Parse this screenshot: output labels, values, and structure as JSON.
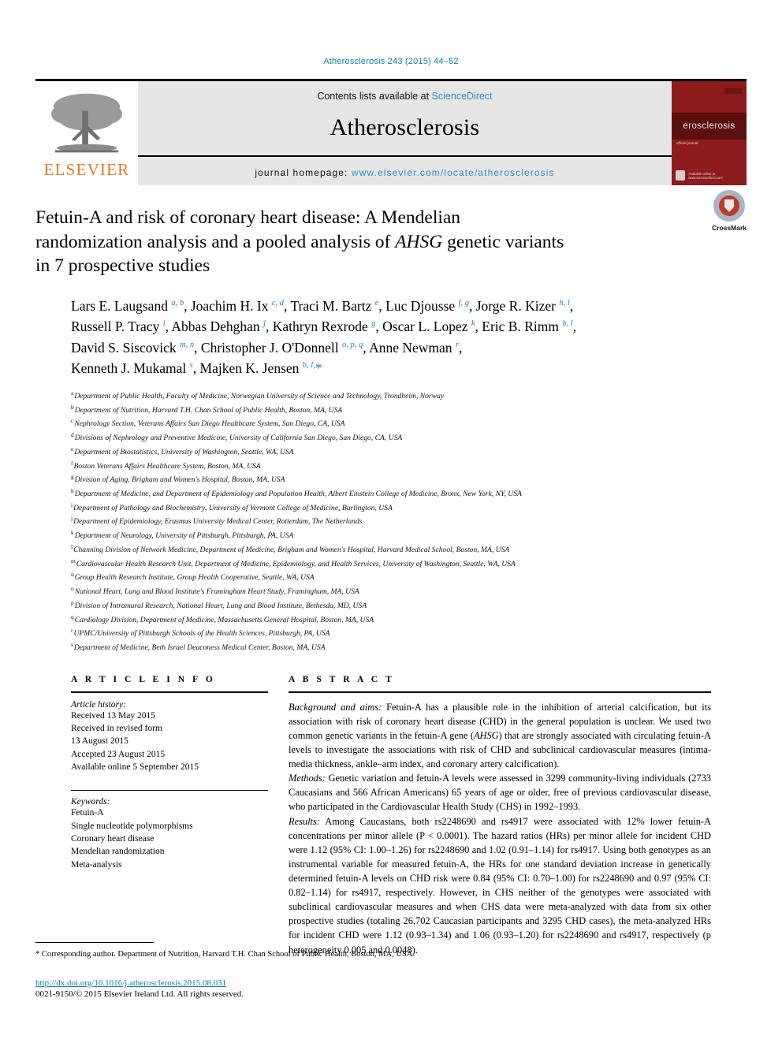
{
  "running_head": "Atherosclerosis 243 (2015) 44–52",
  "masthead": {
    "publisher_name": "ELSEVIER",
    "publisher_logo_icon": "elsevier-tree-icon",
    "contents_prefix": "Contents lists available at ",
    "contents_link": "ScienceDirect",
    "journal_name": "Atherosclerosis",
    "homepage_label": "journal homepage: ",
    "homepage_url": "www.elsevier.com/locate/atherosclerosis",
    "cover_title": "erosclerosis",
    "cover_subtitle": "official journal",
    "cover_footer": "Available online at www.sciencedirect.com"
  },
  "title": {
    "line1": "Fetuin-A and risk of coronary heart disease: A Mendelian",
    "line2_pre": "randomization analysis and a pooled analysis of ",
    "line2_italic": "AHSG",
    "line2_post": " genetic variants",
    "line3": "in 7 prospective studies"
  },
  "crossmark": {
    "label": "CrossMark",
    "icon": "crossmark-icon"
  },
  "authors_html": "Lars E. Laugsand <sup>a, b</sup>, Joachim H. Ix <sup>c, d</sup>, Traci M. Bartz <sup>e</sup>, Luc Djousse <sup>f, g</sup>, Jorge R. Kizer <sup>h, l</sup>,<br>Russell P. Tracy <sup>i</sup>, Abbas Dehghan <sup>j</sup>, Kathryn Rexrode <sup>g</sup>, Oscar L. Lopez <sup>k</sup>, Eric B. Rimm <sup>b, l</sup>,<br>David S. Siscovick <sup>m, n</sup>, Christopher J. O'Donnell <sup>o, p, q</sup>, Anne Newman <sup>r</sup>,<br>Kenneth J. Mukamal <sup>s</sup>, Majken K. Jensen <sup>b, l,</sup><span class=\"corr\">*</span>",
  "affiliations": [
    {
      "marker": "a",
      "text": "Department of Public Health, Faculty of Medicine, Norwegian University of Science and Technology, Trondheim, Norway"
    },
    {
      "marker": "b",
      "text": "Department of Nutrition, Harvard T.H. Chan School of Public Health, Boston, MA, USA"
    },
    {
      "marker": "c",
      "text": "Nephrology Section, Veterans Affairs San Diego Healthcare System, San Diego, CA, USA"
    },
    {
      "marker": "d",
      "text": "Divisions of Nephrology and Preventive Medicine, University of California San Diego, San Diego, CA, USA"
    },
    {
      "marker": "e",
      "text": "Department of Biostatistics, University of Washington, Seattle, WA, USA"
    },
    {
      "marker": "f",
      "text": "Boston Veterans Affairs Healthcare System, Boston, MA, USA"
    },
    {
      "marker": "g",
      "text": "Division of Aging, Brigham and Women's Hospital, Boston, MA, USA"
    },
    {
      "marker": "h",
      "text": "Department of Medicine, and Department of Epidemiology and Population Health, Albert Einstein College of Medicine, Bronx, New York, NY, USA"
    },
    {
      "marker": "i",
      "text": "Department of Pathology and Biochemistry, University of Vermont College of Medicine, Burlington, USA"
    },
    {
      "marker": "j",
      "text": "Department of Epidemiology, Erasmus University Medical Center, Rotterdam, The Netherlands"
    },
    {
      "marker": "k",
      "text": "Department of Neurology, University of Pittsburgh, Pittsburgh, PA, USA"
    },
    {
      "marker": "l",
      "text": "Channing Division of Network Medicine, Department of Medicine, Brigham and Women's Hospital, Harvard Medical School, Boston, MA, USA"
    },
    {
      "marker": "m",
      "text": "Cardiovascular Health Research Unit, Department of Medicine, Epidemiology, and Health Services, University of Washington, Seattle, WA, USA"
    },
    {
      "marker": "n",
      "text": "Group Health Research Institute, Group Health Cooperative, Seattle, WA, USA"
    },
    {
      "marker": "o",
      "text": "National Heart, Lung and Blood Institute's Framingham Heart Study, Framingham, MA, USA"
    },
    {
      "marker": "p",
      "text": "Division of Intramural Research, National Heart, Lung and Blood Institute, Bethesda, MD, USA"
    },
    {
      "marker": "q",
      "text": "Cardiology Division, Department of Medicine, Massachusetts General Hospital, Boston, MA, USA"
    },
    {
      "marker": "r",
      "text": "UPMC/University of Pittsburgh Schools of the Health Sciences, Pittsburgh, PA, USA"
    },
    {
      "marker": "s",
      "text": "Department of Medicine, Beth Israel Deaconess Medical Center, Boston, MA, USA"
    }
  ],
  "article_info": {
    "heading": "A R T I C L E   I N F O",
    "history_label": "Article history:",
    "history": [
      "Received 13 May 2015",
      "Received in revised form",
      "13 August 2015",
      "Accepted 23 August 2015",
      "Available online 5 September 2015"
    ],
    "keywords_label": "Keywords:",
    "keywords": [
      "Fetuin-A",
      "Single nucleotide polymorphisms",
      "Coronary heart disease",
      "Mendelian randomization",
      "Meta-analysis"
    ]
  },
  "abstract": {
    "heading": "A B S T R A C T",
    "background_label": "Background and aims:",
    "background_text": " Fetuin-A has a plausible role in the inhibition of arterial calcification, but its association with risk of coronary heart disease (CHD) in the general population is unclear. We used two common genetic variants in the fetuin-A gene (AHSG) that are strongly associated with circulating fetuin-A levels to investigate the associations with risk of CHD and subclinical cardiovascular measures (intima-media thickness, ankle–arm index, and coronary artery calcification).",
    "methods_label": "Methods:",
    "methods_text": " Genetic variation and fetuin-A levels were assessed in 3299 community-living individuals (2733 Caucasians and 566 African Americans) 65 years of age or older, free of previous cardiovascular disease, who participated in the Cardiovascular Health Study (CHS) in 1992–1993.",
    "results_label": "Results:",
    "results_text": " Among Caucasians, both rs2248690 and rs4917 were associated with 12% lower fetuin-A concentrations per minor allele (P < 0.0001). The hazard ratios (HRs) per minor allele for incident CHD were 1.12 (95% CI: 1.00–1.26) for rs2248690 and 1.02 (0.91–1.14) for rs4917. Using both genotypes as an instrumental variable for measured fetuin-A, the HRs for one standard deviation increase in genetically determined fetuin-A levels on CHD risk were 0.84 (95% CI: 0.70–1.00) for rs2248690 and 0.97 (95% CI: 0.82–1.14) for rs4917, respectively. However, in CHS neither of the genotypes were associated with subclinical cardiovascular measures and when CHS data were meta-analyzed with data from six other prospective studies (totaling 26,702 Caucasian participants and 3295 CHD cases), the meta-analyzed HRs for incident CHD were 1.12 (0.93–1.34) and 1.06 (0.93–1.20) for rs2248690 and rs4917, respectively (p heterogeneity 0.005 and 0.0048)."
  },
  "footer": {
    "corresponding_marker": "*",
    "corresponding_text": " Corresponding author. Department of Nutrition, Harvard T.H. Chan School of Public Health, Boston, MA, USA.",
    "doi": "http://dx.doi.org/10.1016/j.atherosclerosis.2015.08.031",
    "copyright": "0021-9150/© 2015 Elsevier Ireland Ltd. All rights reserved."
  },
  "colors": {
    "link_blue": "#0b7fab",
    "sciencedirect_blue": "#2c8fc9",
    "elsevier_orange": "#e87722",
    "cover_red": "#8d1b1b",
    "superscript_blue": "#1f7fb5"
  }
}
